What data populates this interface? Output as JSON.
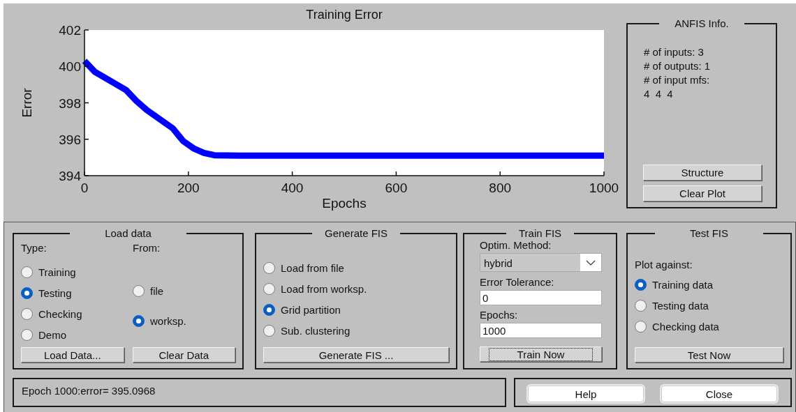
{
  "chart": {
    "chart_data": {
      "type": "line",
      "title": "Training Error",
      "xlabel": "Epochs",
      "ylabel": "Error",
      "x": [
        0,
        20,
        50,
        80,
        100,
        120,
        150,
        170,
        190,
        210,
        230,
        250,
        300,
        400,
        600,
        800,
        1000
      ],
      "series": [
        {
          "color": "#0000ff",
          "values": [
            400.3,
            399.7,
            399.2,
            398.7,
            398.1,
            397.6,
            397.0,
            396.6,
            395.9,
            395.5,
            395.25,
            395.12,
            395.1,
            395.1,
            395.1,
            395.1,
            395.1
          ]
        }
      ],
      "xlim": [
        0,
        1000
      ],
      "ylim": [
        394,
        402
      ],
      "xticks": [
        0,
        200,
        400,
        600,
        800,
        1000
      ],
      "yticks": [
        394,
        396,
        398,
        400,
        402
      ]
    }
  },
  "anfis_info": {
    "title": "ANFIS Info.",
    "lines": [
      "# of inputs: 3",
      "# of outputs: 1",
      "# of input mfs:",
      "4  4  4"
    ],
    "buttons": [
      "Structure",
      "Clear Plot"
    ]
  },
  "load_data": {
    "title": "Load data",
    "type_label": "Type:",
    "from_label": "From:",
    "types": [
      {
        "label": "Training",
        "selected": false
      },
      {
        "label": "Testing",
        "selected": true
      },
      {
        "label": "Checking",
        "selected": false
      },
      {
        "label": "Demo",
        "selected": false
      }
    ],
    "sources": [
      {
        "label": "file",
        "selected": false
      },
      {
        "label": "worksp.",
        "selected": true
      }
    ],
    "buttons": [
      "Load Data...",
      "Clear Data"
    ]
  },
  "generate_fis": {
    "title": "Generate FIS",
    "options": [
      {
        "label": "Load from file",
        "selected": false
      },
      {
        "label": "Load from worksp.",
        "selected": false
      },
      {
        "label": "Grid partition",
        "selected": true
      },
      {
        "label": "Sub. clustering",
        "selected": false
      }
    ],
    "button": "Generate FIS ..."
  },
  "train_fis": {
    "title": "Train FIS",
    "method_label": "Optim. Method:",
    "method": "hybrid",
    "tolerance_label": "Error Tolerance:",
    "tolerance": "0",
    "epochs_label": "Epochs:",
    "epochs": "1000",
    "button": "Train Now",
    "button_focused": true
  },
  "test_fis": {
    "title": "Test FIS",
    "plot_label": "Plot against:",
    "options": [
      {
        "label": "Training data",
        "selected": true
      },
      {
        "label": "Testing data",
        "selected": false
      },
      {
        "label": "Checking data",
        "selected": false
      }
    ],
    "button": "Test Now"
  },
  "status": "Epoch 1000:error= 395.0968",
  "buttons": [
    "Help",
    "Close"
  ]
}
